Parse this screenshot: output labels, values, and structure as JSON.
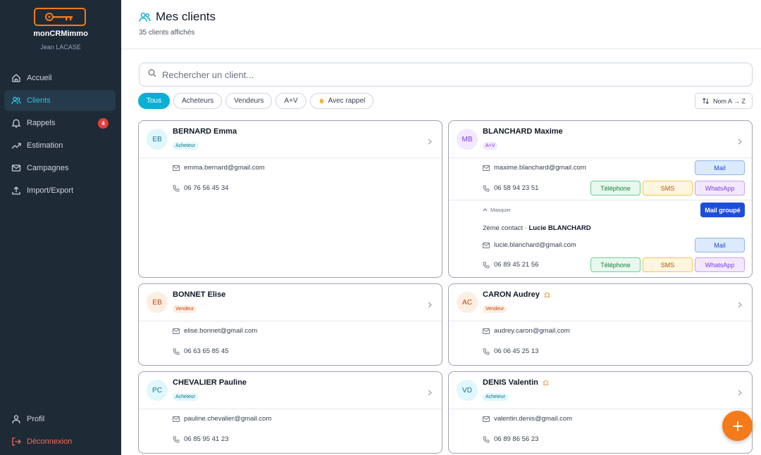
{
  "sidebar": {
    "app_name": "monCRMimmo",
    "user_name": "Jean LACASE",
    "items": [
      {
        "label": "Accueil",
        "icon": "home-icon"
      },
      {
        "label": "Clients",
        "icon": "users-icon"
      },
      {
        "label": "Rappels",
        "icon": "bell-icon",
        "badge": "4"
      },
      {
        "label": "Estimation",
        "icon": "trend-icon"
      },
      {
        "label": "Campagnes",
        "icon": "mail-icon"
      },
      {
        "label": "Import/Export",
        "icon": "upload-icon"
      }
    ],
    "profile_label": "Profil",
    "logout_label": "Déconnexion"
  },
  "header": {
    "title": "Mes clients",
    "subtitle": "35 clients affichés"
  },
  "search": {
    "placeholder": "Rechercher un client..."
  },
  "filters": {
    "chips": [
      "Tous",
      "Acheteurs",
      "Vendeurs",
      "A+V",
      "Avec rappel"
    ],
    "active": "Tous",
    "sort_label": "Nom A → Z"
  },
  "actions": {
    "mail": "Mail",
    "telephone": "Téléphone",
    "sms": "SMS",
    "whatsapp": "WhatsApp",
    "mail_group": "Mail groupé",
    "hide": "Masquer",
    "second_contact_prefix": "2ème contact · "
  },
  "clients": [
    {
      "initials": "EB",
      "name": "BERNARD Emma",
      "type": "Acheteur",
      "email": "emma.bernard@gmail.com",
      "phone": "06 76 56 45 34"
    },
    {
      "initials": "MB",
      "name": "BLANCHARD Maxime",
      "type": "A+V",
      "email": "maxime.blanchard@gmail.com",
      "phone": "06 58 94 23 51",
      "second_contact": {
        "name": "Lucie BLANCHARD",
        "email": "lucie.blanchard@gmail.com",
        "phone": "06 89 45 21 56"
      }
    },
    {
      "initials": "EB",
      "name": "BONNET Elise",
      "type": "Vendeur",
      "email": "elise.bonnet@gmail.com",
      "phone": "06 63 65 85 45"
    },
    {
      "initials": "AC",
      "name": "CARON Audrey",
      "type": "Vendeur",
      "email": "audrey.caron@gmail.com",
      "phone": "06 06 45 25 13",
      "reminder": true
    },
    {
      "initials": "PC",
      "name": "CHEVALIER Pauline",
      "type": "Acheteur",
      "email": "pauline.chevalier@gmail.com",
      "phone": "06 85 95 41 23"
    },
    {
      "initials": "VD",
      "name": "DENIS Valentin",
      "type": "Acheteur",
      "email": "valentin.denis@gmail.com",
      "phone": "06 89 86 56 23",
      "reminder": true
    }
  ],
  "colors": {
    "accent": "#0ab0d4",
    "sidebar": "#1e2a36",
    "fab": "#f47a1a"
  }
}
